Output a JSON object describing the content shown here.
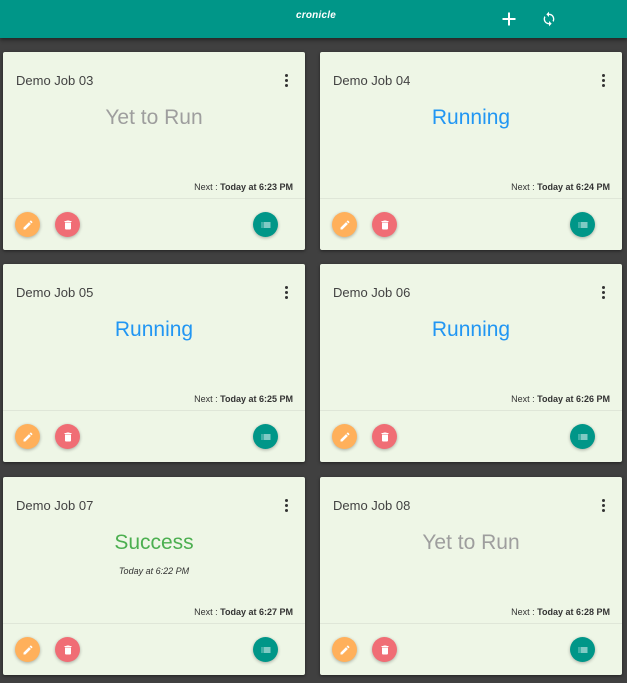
{
  "app": {
    "title": "cronicle",
    "add_icon": "plus-icon",
    "refresh_icon": "sync-icon"
  },
  "colors": {
    "appbar": "#009688",
    "background": "#404040",
    "card": "#eef6e6",
    "status_pending": "#9e9e9e",
    "status_running": "#2196f3",
    "status_success": "#4caf50",
    "edit_fab": "#ffb05b",
    "delete_fab": "#f06d75",
    "logs_fab": "#009688"
  },
  "jobs": [
    {
      "name": "Demo Job 03",
      "status": "Yet to Run",
      "status_type": "pending",
      "last_run": "",
      "next_label": "Next :",
      "next_value": "Today at 6:23 PM"
    },
    {
      "name": "Demo Job 04",
      "status": "Running",
      "status_type": "running",
      "last_run": "",
      "next_label": "Next :",
      "next_value": "Today at 6:24 PM"
    },
    {
      "name": "Demo Job 05",
      "status": "Running",
      "status_type": "running",
      "last_run": "",
      "next_label": "Next :",
      "next_value": "Today at 6:25 PM"
    },
    {
      "name": "Demo Job 06",
      "status": "Running",
      "status_type": "running",
      "last_run": "",
      "next_label": "Next :",
      "next_value": "Today at 6:26 PM"
    },
    {
      "name": "Demo Job 07",
      "status": "Success",
      "status_type": "success",
      "last_run": "Today at 6:22 PM",
      "next_label": "Next :",
      "next_value": "Today at 6:27 PM"
    },
    {
      "name": "Demo Job 08",
      "status": "Yet to Run",
      "status_type": "pending",
      "last_run": "",
      "next_label": "Next :",
      "next_value": "Today at 6:28 PM"
    }
  ],
  "card_actions": {
    "menu_icon": "more-vert-icon",
    "edit_icon": "pencil-icon",
    "delete_icon": "trash-icon",
    "logs_icon": "list-icon"
  }
}
